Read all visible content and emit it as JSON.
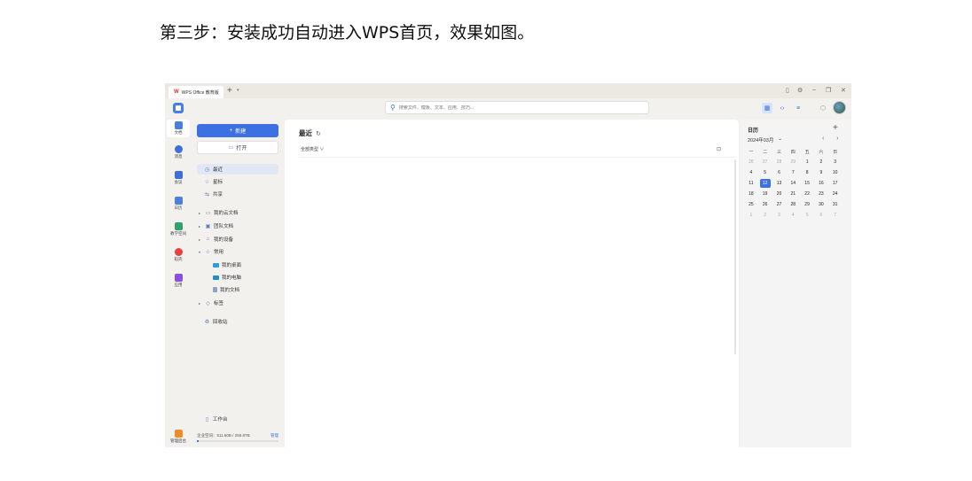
{
  "caption": "第三步：安装成功自动进入WPS首页，效果如图。",
  "titlebar": {
    "logo": "W",
    "tab_label": "WPS Office 教育版",
    "new_tab": "+",
    "tab_dropdown": "▾",
    "controls": [
      "▯",
      "⚙",
      "–",
      "❐",
      "✕"
    ]
  },
  "toolbar": {
    "search_placeholder": "搜索文件、模板、文本、应用、技巧..."
  },
  "rail": [
    {
      "label": "文档",
      "icon": "document-icon",
      "color": "#4a7fe0"
    },
    {
      "label": "消息",
      "icon": "message-icon",
      "color": "#3c6fd8"
    },
    {
      "label": "会议",
      "icon": "meeting-icon",
      "color": "#3c6fd8"
    },
    {
      "label": "日历",
      "icon": "calendar-icon",
      "color": "#4a7fe0"
    },
    {
      "label": "教学空间",
      "icon": "teaching-space-icon",
      "color": "#2fa36b"
    },
    {
      "label": "稻壳",
      "icon": "docer-icon",
      "color": "#e8403c"
    },
    {
      "label": "应用",
      "icon": "apps-icon",
      "color": "#8a4fe0"
    }
  ],
  "rail_bottom": {
    "label": "管理后台",
    "icon": "admin-icon",
    "color": "#f08a24"
  },
  "nav": {
    "new_label": "新建",
    "open_label": "打开",
    "items": [
      {
        "label": "最近",
        "icon": "◷"
      },
      {
        "label": "星标",
        "icon": "☆"
      },
      {
        "label": "共享",
        "icon": "⇆"
      },
      {
        "label": "我的云文档",
        "icon": "▭"
      },
      {
        "label": "团队文档",
        "icon": "▣"
      },
      {
        "label": "我的设备",
        "icon": "⌂"
      },
      {
        "label": "常用",
        "icon": "☆"
      },
      {
        "label": "我的桌面",
        "icon": ""
      },
      {
        "label": "我的电脑",
        "icon": ""
      },
      {
        "label": "我的文档",
        "icon": ""
      },
      {
        "label": "标签",
        "icon": "◇"
      },
      {
        "label": "回收站",
        "icon": "♻"
      },
      {
        "label": "工作台",
        "icon": "▯"
      }
    ],
    "storage_label": "企业空间：511.60B / 258.8TB",
    "manage_label": "管理",
    "storage_fraction": 0.02
  },
  "main": {
    "title": "最近",
    "refresh_icon": "↻",
    "filter_label": "全部类型 ∨"
  },
  "calendar": {
    "title": "日历",
    "add": "+",
    "month": "2024年03月",
    "nav": "‹ ›",
    "weekdays": [
      "一",
      "二",
      "三",
      "四",
      "五",
      "六",
      "日"
    ],
    "days": [
      [
        "26",
        "27",
        "28",
        "29",
        "1",
        "2",
        "3"
      ],
      [
        "4",
        "5",
        "6",
        "7",
        "8",
        "9",
        "10"
      ],
      [
        "11",
        "12",
        "13",
        "14",
        "15",
        "16",
        "17"
      ],
      [
        "18",
        "19",
        "20",
        "21",
        "22",
        "23",
        "24"
      ],
      [
        "25",
        "26",
        "27",
        "28",
        "29",
        "30",
        "31"
      ],
      [
        "1",
        "2",
        "3",
        "4",
        "5",
        "6",
        "7"
      ]
    ],
    "today": "12"
  }
}
